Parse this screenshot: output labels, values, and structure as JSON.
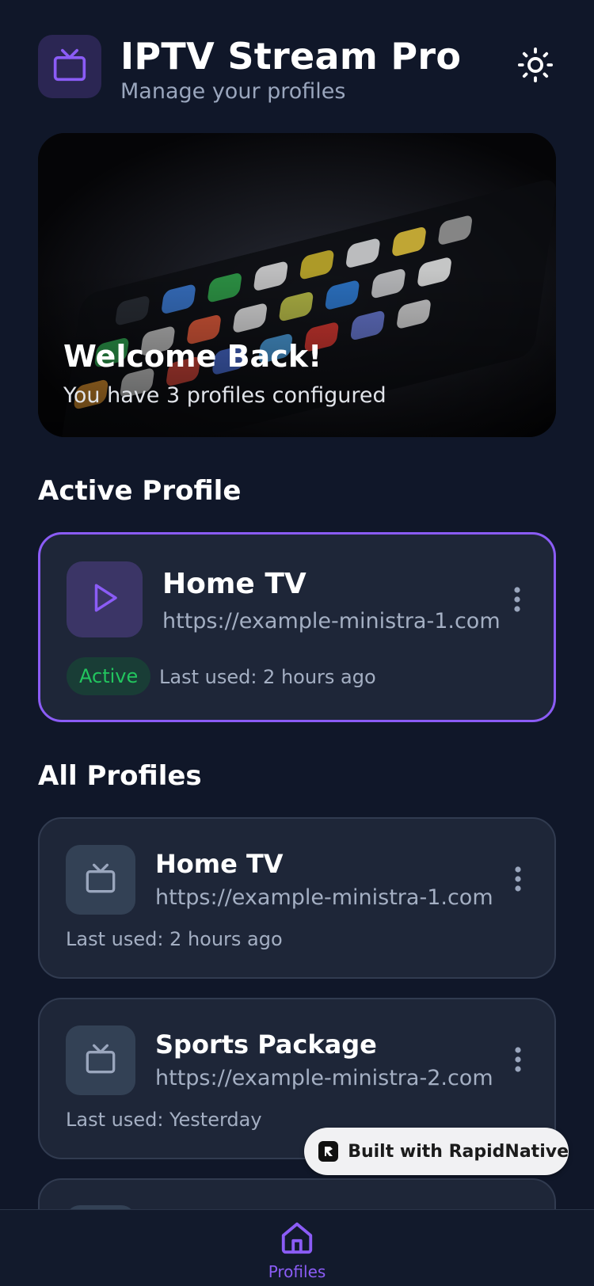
{
  "header": {
    "title": "IPTV Stream Pro",
    "subtitle": "Manage your profiles",
    "logo_icon": "tv-icon",
    "theme_toggle_icon": "sun-icon"
  },
  "hero": {
    "title": "Welcome Back!",
    "subtitle": "You have 3 profiles configured"
  },
  "active_section": {
    "heading": "Active Profile",
    "profile": {
      "name": "Home TV",
      "url": "https://example-ministra-1.com",
      "status": "Active",
      "last_used": "Last used: 2 hours ago",
      "icon": "play-icon"
    }
  },
  "all_section": {
    "heading": "All Profiles",
    "profiles": [
      {
        "name": "Home TV",
        "url": "https://example-ministra-1.com",
        "last_used": "Last used: 2 hours ago",
        "icon": "tv-icon"
      },
      {
        "name": "Sports Package",
        "url": "https://example-ministra-2.com",
        "last_used": "Last used: Yesterday",
        "icon": "tv-icon"
      }
    ]
  },
  "badge": {
    "text": "Built with RapidNative"
  },
  "nav": {
    "items": [
      {
        "label": "Profiles",
        "icon": "home-icon",
        "active": true
      }
    ]
  },
  "colors": {
    "background": "#101729",
    "card": "#1e2638",
    "accent": "#8b5cf6",
    "active_status": "#22c55e",
    "muted_text": "#a4afc3"
  }
}
